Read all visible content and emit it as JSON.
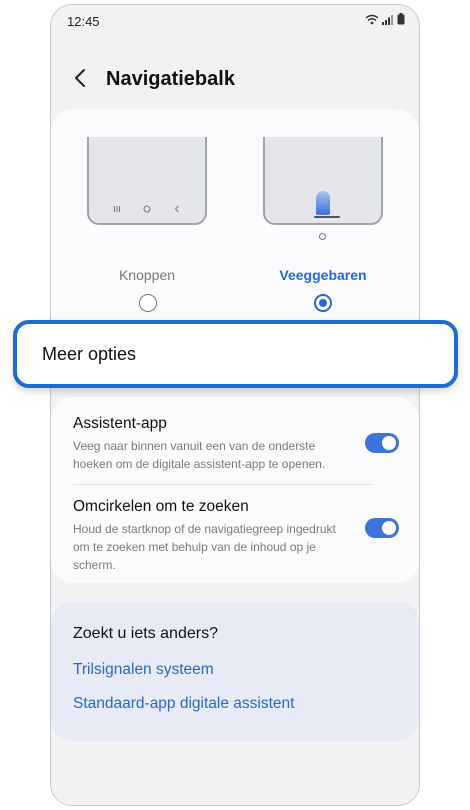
{
  "status_bar": {
    "time": "12:45",
    "icons": [
      "wifi-icon",
      "signal-icon",
      "battery-icon"
    ]
  },
  "header": {
    "title": "Navigatiebalk",
    "back_icon": "chevron-left-icon"
  },
  "navigation_type": {
    "options": [
      {
        "label": "Knoppen",
        "selected": false
      },
      {
        "label": "Veeggebaren",
        "selected": true
      }
    ],
    "selected_color": "#2767d8"
  },
  "more_options": {
    "label": "Meer opties",
    "highlight_color": "#1d6ad1"
  },
  "settings": [
    {
      "title": "Assistent-app",
      "description": "Veeg naar binnen vanuit een van de onderste hoeken om de digitale assistent-app te openen.",
      "enabled": true
    },
    {
      "title": "Omcirkelen om te zoeken",
      "description": "Houd de startknop of de navigatiegreep ingedrukt om te zoeken met behulp van de inhoud op je scherm.",
      "enabled": true
    }
  ],
  "help": {
    "title": "Zoekt u iets anders?",
    "links": [
      "Trilsignalen systeem",
      "Standaard-app digitale assistent"
    ],
    "link_color": "#2d66c6"
  },
  "colors": {
    "toggle_on": "#3d74dc",
    "page_background": "#f2f2f4",
    "help_card_background": "#e6ebf6"
  }
}
